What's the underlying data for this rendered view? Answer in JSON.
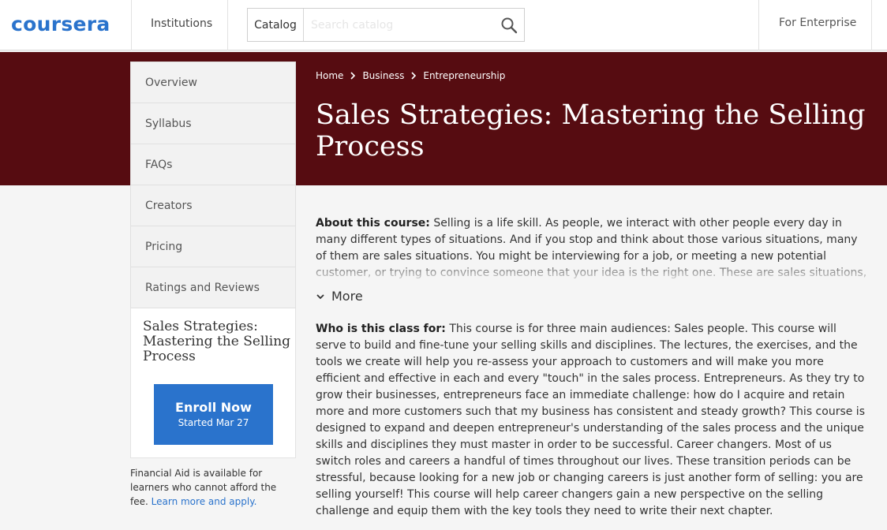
{
  "header": {
    "logo": "coursera",
    "institutions": "Institutions",
    "catalog": "Catalog",
    "search_placeholder": "Search catalog",
    "enterprise": "For Enterprise"
  },
  "breadcrumb": [
    "Home",
    "Business",
    "Entrepreneurship"
  ],
  "course_title": "Sales Strategies: Mastering the Selling Process",
  "sidebar": {
    "nav": [
      "Overview",
      "Syllabus",
      "FAQs",
      "Creators",
      "Pricing",
      "Ratings and Reviews"
    ],
    "card_title": "Sales Strategies: Mastering the Selling Process",
    "enroll_label": "Enroll Now",
    "enroll_sub": "Started Mar 27",
    "finaid_text": "Financial Aid is available for learners who cannot afford the fee.",
    "finaid_link": "Learn more and apply."
  },
  "about": {
    "label": "About this course:",
    "text": "Selling is a life skill. As people, we interact with other people every day in many different types of situations. And if you stop and think about those various situations, many of them are sales situations. You might be interviewing for a job, or meeting a new potential customer, or trying to convince someone that your idea is the right one. These are sales situations, and in this course you will"
  },
  "more_label": "More",
  "who": {
    "label": "Who is this class for:",
    "text": "This course is for three main audiences: Sales people. This course will serve to build and fine-tune your selling skills and disciplines. The lectures, the exercises, and the tools we create will help you re-assess your approach to customers and will make you more efficient and effective in each and every \"touch\" in the sales process. Entrepreneurs. As they try to grow their businesses, entrepreneurs face an immediate challenge: how do I acquire and retain more and more customers such that my business has consistent and steady growth? This course is designed to expand and deepen entrepreneur's understanding of the sales process and the unique skills and disciplines they must master in order to be successful. Career changers. Most of us switch roles and careers a handful of times throughout our lives. These transition periods can be stressful, because looking for a new job or changing careers is just another form of selling: you are selling yourself! This course will help career changers gain a new perspective on the selling challenge and equip them with the key tools they need to write their next chapter."
  },
  "colors": {
    "brand_blue": "#2a73cc",
    "hero_maroon": "#560c11"
  },
  "icons": [
    "search-icon",
    "chevron-right-icon",
    "chevron-down-icon"
  ]
}
